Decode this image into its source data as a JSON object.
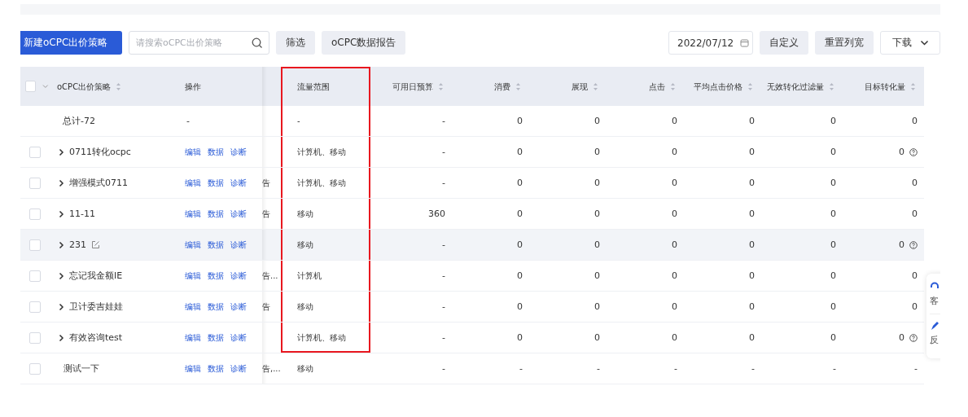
{
  "toolbar": {
    "create_button": "新建oCPC出价策略",
    "search": {
      "placeholder": "请搜索oCPC出价策略"
    },
    "filter_button": "筛选",
    "report_button": "oCPC数据报告",
    "date": "2022/07/12",
    "custom_button": "自定义",
    "reset_button": "重置列宽",
    "download_button": "下载"
  },
  "table": {
    "header_checked": false,
    "columns": [
      {
        "label": "oCPC出价策略",
        "sortable": true,
        "highlighted": false
      },
      {
        "label": "操作",
        "sortable": false,
        "highlighted": false
      },
      {
        "label": "流量范围",
        "sortable": false,
        "highlighted": true
      },
      {
        "label": "可用日预算",
        "sortable": true,
        "highlighted": false
      },
      {
        "label": "消费",
        "sortable": true,
        "highlighted": false
      },
      {
        "label": "展现",
        "sortable": true,
        "highlighted": false
      },
      {
        "label": "点击",
        "sortable": true,
        "highlighted": false
      },
      {
        "label": "平均点击价格",
        "sortable": true,
        "highlighted": false
      },
      {
        "label": "无效转化过滤量",
        "sortable": true,
        "highlighted": false
      },
      {
        "label": "目标转化量",
        "sortable": true,
        "highlighted": false
      }
    ],
    "rows": [
      {
        "kind": "total",
        "name": "总计-72",
        "actions": [
          "-"
        ],
        "column_3": "",
        "traffic": "-",
        "values": [
          "-",
          "0",
          "0",
          "0",
          "0",
          "0",
          "0"
        ],
        "help": false,
        "hovered": false,
        "highlighted": true
      },
      {
        "kind": "item",
        "checked": false,
        "expandable": true,
        "editable": false,
        "name": "0711转化ocpc",
        "actions": [
          "编辑",
          "数据",
          "诊断"
        ],
        "column_3": "",
        "traffic": "计算机、移动",
        "values": [
          "-",
          "0",
          "0",
          "0",
          "0",
          "0",
          "0"
        ],
        "help": true,
        "hovered": false,
        "highlighted": true
      },
      {
        "kind": "item",
        "checked": false,
        "expandable": true,
        "editable": false,
        "name": "增强模式0711",
        "actions": [
          "编辑",
          "数据",
          "诊断"
        ],
        "column_3": "告",
        "traffic": "计算机、移动",
        "values": [
          "-",
          "0",
          "0",
          "0",
          "0",
          "0",
          "0"
        ],
        "help": false,
        "hovered": false,
        "highlighted": true
      },
      {
        "kind": "item",
        "checked": false,
        "expandable": true,
        "editable": false,
        "name": "11-11",
        "actions": [
          "编辑",
          "数据",
          "诊断"
        ],
        "column_3": "告",
        "traffic": "移动",
        "values": [
          "360",
          "0",
          "0",
          "0",
          "0",
          "0",
          "0"
        ],
        "help": false,
        "hovered": false,
        "highlighted": true
      },
      {
        "kind": "item",
        "checked": false,
        "expandable": true,
        "editable": true,
        "name": "231",
        "actions": [
          "编辑",
          "数据",
          "诊断"
        ],
        "column_3": "",
        "traffic": "移动",
        "values": [
          "-",
          "0",
          "0",
          "0",
          "0",
          "0",
          "0"
        ],
        "help": true,
        "hovered": true,
        "highlighted": true
      },
      {
        "kind": "item",
        "checked": false,
        "expandable": true,
        "editable": false,
        "name": "忘记我金额IE",
        "actions": [
          "编辑",
          "数据",
          "诊断"
        ],
        "column_3": "告...",
        "traffic": "计算机",
        "values": [
          "-",
          "0",
          "0",
          "0",
          "0",
          "0",
          "0"
        ],
        "help": false,
        "hovered": false,
        "highlighted": true
      },
      {
        "kind": "item",
        "checked": false,
        "expandable": true,
        "editable": false,
        "name": "卫计委吉娃娃",
        "actions": [
          "编辑",
          "数据",
          "诊断"
        ],
        "column_3": "告",
        "traffic": "移动",
        "values": [
          "-",
          "0",
          "0",
          "0",
          "0",
          "0",
          "0"
        ],
        "help": false,
        "hovered": false,
        "highlighted": true
      },
      {
        "kind": "item",
        "checked": false,
        "expandable": true,
        "editable": false,
        "name": "有效咨询test",
        "actions": [
          "编辑",
          "数据",
          "诊断"
        ],
        "column_3": "",
        "traffic": "计算机、移动",
        "values": [
          "-",
          "0",
          "0",
          "0",
          "0",
          "0",
          "0"
        ],
        "help": true,
        "hovered": false,
        "highlighted": true
      },
      {
        "kind": "item",
        "checked": false,
        "expandable": false,
        "editable": false,
        "name": "测试一下",
        "actions": [
          "编辑",
          "数据",
          "诊断"
        ],
        "column_3": "告,...",
        "traffic": "移动",
        "values": [
          "-",
          "-",
          "-",
          "-",
          "-",
          "-",
          "-"
        ],
        "help": false,
        "hovered": false,
        "highlighted": false
      }
    ]
  },
  "side_widget": {
    "items": [
      {
        "label": "客"
      },
      {
        "label": "反"
      }
    ]
  }
}
